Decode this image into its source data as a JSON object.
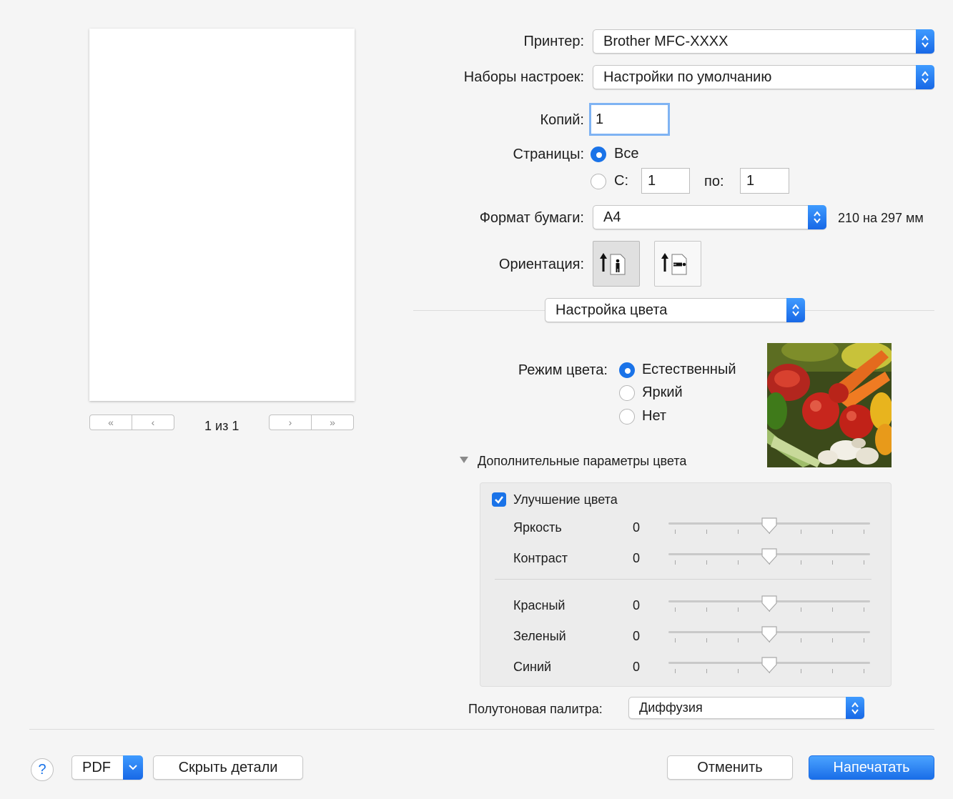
{
  "printer": {
    "label": "Принтер:",
    "value": "Brother MFC-XXXX"
  },
  "presets": {
    "label": "Наборы настроек:",
    "value": "Настройки по умолчанию"
  },
  "copies": {
    "label": "Копий:",
    "value": "1"
  },
  "pages": {
    "label": "Страницы:",
    "all_label": "Все",
    "from_label": "С:",
    "from_value": "1",
    "to_label": "по:",
    "to_value": "1",
    "selected": "all"
  },
  "paper": {
    "label": "Формат бумаги:",
    "value": "A4",
    "size_text": "210 на 297 мм"
  },
  "orientation": {
    "label": "Ориентация:",
    "selected": "portrait"
  },
  "section_popup": {
    "value": "Настройка цвета"
  },
  "color_mode": {
    "label": "Режим цвета:",
    "options": [
      "Естественный",
      "Яркий",
      "Нет"
    ],
    "selected": "Естественный"
  },
  "advanced": {
    "disclosure_label": "Дополнительные параметры цвета",
    "enhance_label": "Улучшение цвета",
    "enhance_checked": true,
    "sliders": [
      {
        "label": "Яркость",
        "value": "0"
      },
      {
        "label": "Контраст",
        "value": "0"
      },
      {
        "label": "Красный",
        "value": "0"
      },
      {
        "label": "Зеленый",
        "value": "0"
      },
      {
        "label": "Синий",
        "value": "0"
      }
    ]
  },
  "halftone": {
    "label": "Полутоновая палитра:",
    "value": "Диффузия"
  },
  "preview": {
    "page_counter": "1 из 1"
  },
  "footer": {
    "help": "?",
    "pdf": "PDF",
    "hide_details": "Скрыть детали",
    "cancel": "Отменить",
    "print": "Напечатать"
  },
  "colors": {
    "accent": "#1a73e8",
    "background": "#f5f5f5"
  }
}
